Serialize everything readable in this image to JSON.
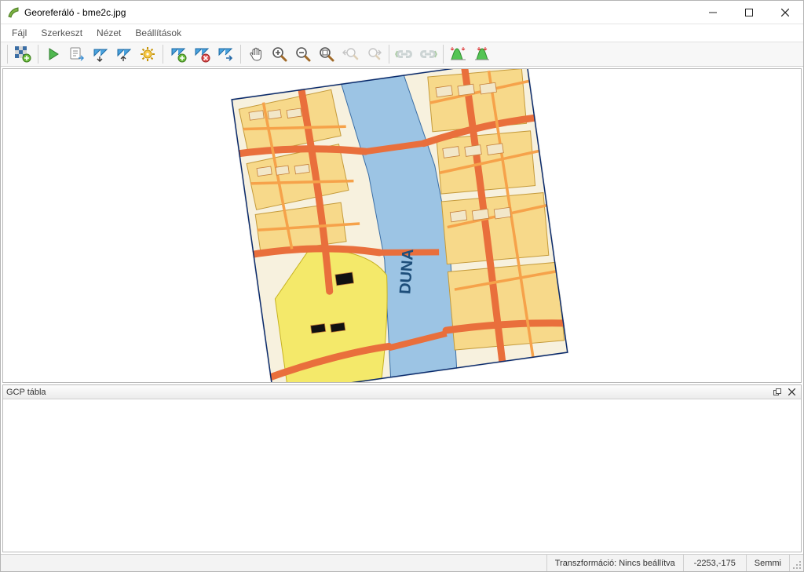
{
  "titlebar": {
    "app_name": "Georeferáló",
    "separator": " - ",
    "file_name": "bme2c.jpg"
  },
  "menu": {
    "file": "Fájl",
    "edit": "Szerkeszt",
    "view": "Nézet",
    "settings": "Beállítások"
  },
  "toolbar": {
    "open_raster": "open-raster",
    "start": "start",
    "generate_script": "generate-script",
    "load_gcp": "load-gcp",
    "save_gcp": "save-gcp",
    "transform_settings": "transform-settings",
    "add_point": "add-point",
    "delete_point": "delete-point",
    "move_point": "move-point",
    "pan": "pan",
    "zoom_in": "zoom-in",
    "zoom_out": "zoom-out",
    "zoom_layer": "zoom-layer",
    "zoom_last": "zoom-last",
    "zoom_next": "zoom-next",
    "link_georef": "link-georef",
    "link_qgis": "link-qgis",
    "histogram": "histogram",
    "local_histogram": "local-histogram"
  },
  "map": {
    "river_label": "DUNA"
  },
  "panel": {
    "title": "GCP tábla"
  },
  "status": {
    "transform_label": "Transzformáció: Nincs beállítva",
    "coords": "-2253,-175",
    "rotation": "Semmi"
  },
  "colors": {
    "river": "#9cc4e4",
    "road_major": "#e96f3c",
    "road_minor": "#f6a24a",
    "block": "#f7d98a",
    "park": "#f4e96a",
    "building_fill": "#f2e7c9",
    "building_stroke": "#c47f3a",
    "outline": "#6b3e1b"
  }
}
